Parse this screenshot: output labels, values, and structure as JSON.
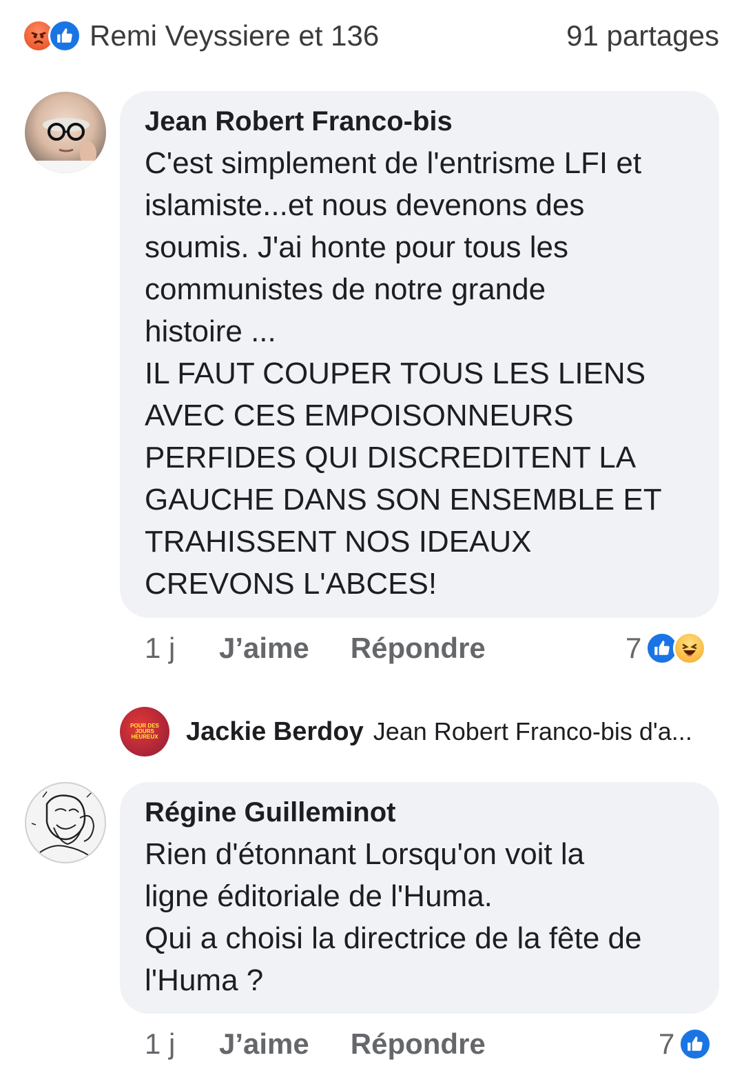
{
  "reactions_summary": {
    "reactor_text": "Remi Veyssiere et 136",
    "shares_text": "91 partages",
    "icons": [
      "angry-icon",
      "like-icon"
    ]
  },
  "comments": [
    {
      "author": "Jean Robert Franco-bis",
      "text": "C'est simplement de l'entrisme LFI et\nislamiste...et nous devenons des\nsoumis. J'ai honte pour tous les\ncommunistes de notre grande\nhistoire ...\nIL FAUT COUPER TOUS LES LIENS\nAVEC CES EMPOISONNEURS\nPERFIDES QUI DISCREDITENT LA\nGAUCHE DANS SON ENSEMBLE ET\nTRAHISSENT NOS IDEAUX\nCREVONS L'ABCES!",
      "time": "1 j",
      "like_label": "J’aime",
      "reply_label": "Répondre",
      "reaction_count": "7",
      "reaction_icons": [
        "like-icon",
        "haha-icon"
      ]
    },
    {
      "author": "Régine Guilleminot",
      "text": "Rien d'étonnant Lorsqu'on voit la\nligne éditoriale de l'Huma.\nQui a choisi la directrice de la fête de\nl'Huma ?",
      "time": "1 j",
      "like_label": "J’aime",
      "reply_label": "Répondre",
      "reaction_count": "7",
      "reaction_icons": [
        "like-icon"
      ]
    }
  ],
  "reply_preview": {
    "author": "Jackie Berdoy",
    "snippet": "Jean Robert Franco-bis d'a...",
    "avatar_logo_text": "POUR DES JOURS HEUREUX"
  },
  "colors": {
    "bubble": "#f0f2f5",
    "like_blue": "#1b74e4",
    "secondary_text": "#65676b"
  }
}
